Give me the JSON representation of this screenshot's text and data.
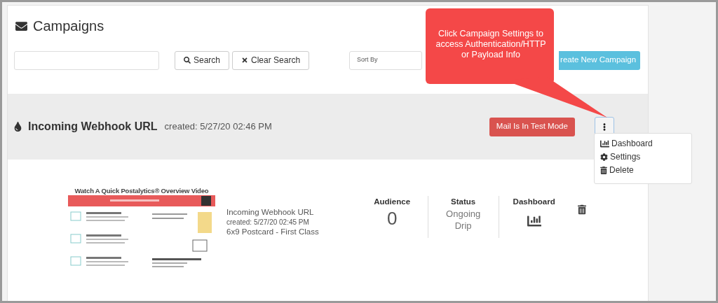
{
  "page": {
    "title": "Campaigns"
  },
  "search": {
    "buttons": [
      {
        "kind": "search",
        "label": "Search"
      },
      {
        "kind": "clear",
        "label": "Clear Search"
      }
    ]
  },
  "sort": {
    "placeholder": "Sort By"
  },
  "create_button": "reate New Campaign",
  "campaign": {
    "name": "Incoming Webhook URL",
    "created": "created: 5/27/20 02:46 PM",
    "test_mode_badge": "Mail Is In Test Mode",
    "menu": {
      "expanded": true,
      "items": [
        {
          "kind": "dashboard",
          "label": "Dashboard"
        },
        {
          "kind": "settings",
          "label": "Settings"
        },
        {
          "kind": "delete",
          "label": "Delete"
        }
      ]
    },
    "preview": {
      "heading": "Watch A Quick Postalytics® Overview Video"
    },
    "details": [
      "Incoming Webhook URL",
      "created: 5/27/20 02:45 PM",
      "6x9 Postcard - First Class"
    ],
    "stats": [
      {
        "kind": "number",
        "label": "Audience",
        "value": "0"
      },
      {
        "kind": "text",
        "label": "Status",
        "value": "Ongoing Drip"
      },
      {
        "kind": "chart_link",
        "label": "Dashboard"
      }
    ]
  },
  "callout": "Click Campaign Settings to access Authentication/HTTP or Payload Info"
}
